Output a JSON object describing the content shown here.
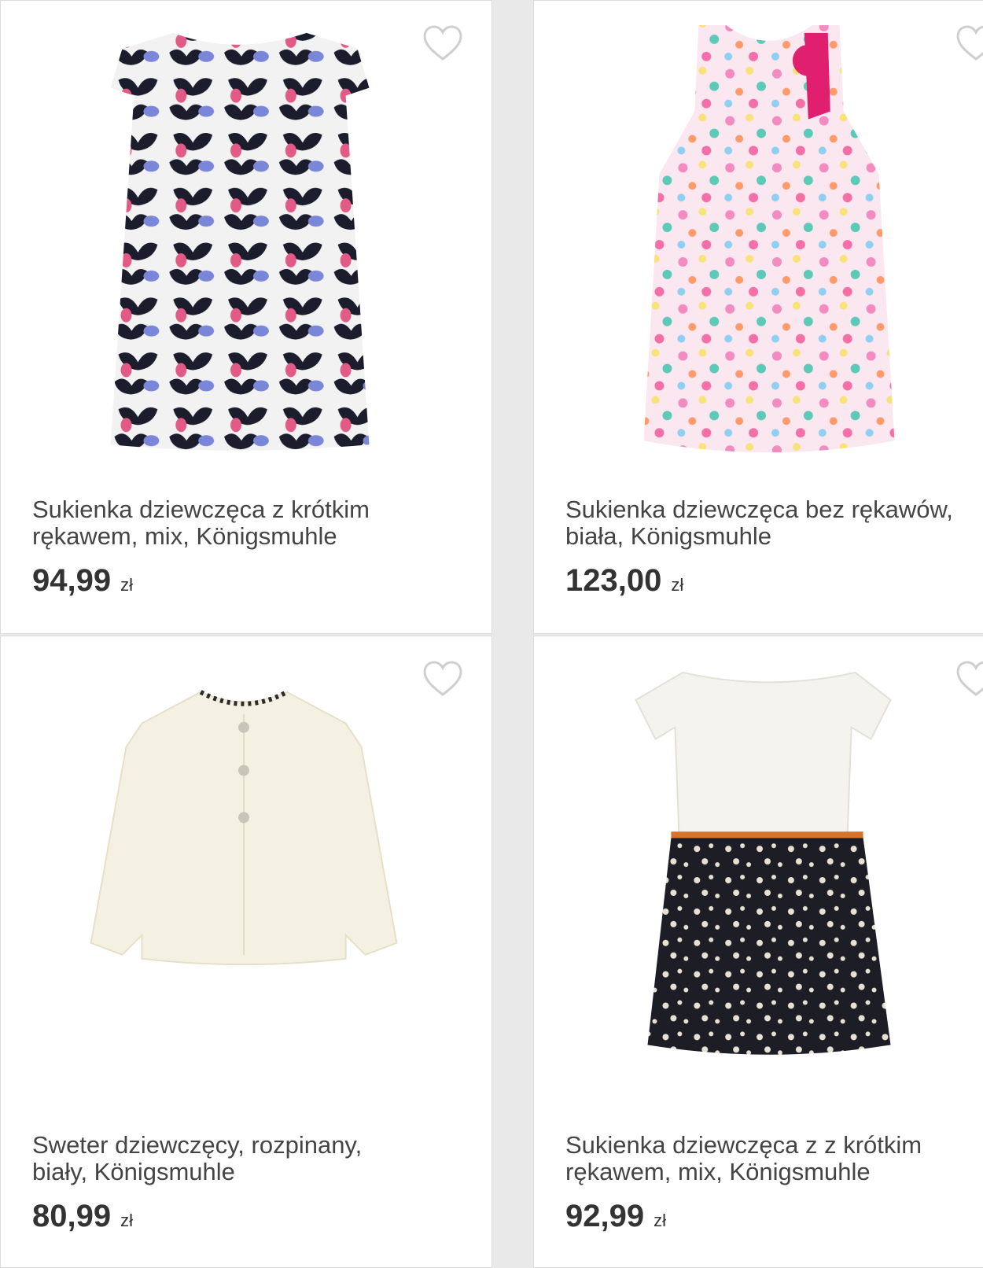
{
  "colors": {
    "background": "#e9e9e9",
    "card": "#ffffff",
    "text": "#444444",
    "heart": "#cfcfcf"
  },
  "products": [
    {
      "title_line1": "Sukienka dziewczęca z krótkim",
      "title_line2": "rękawem, mix, Königsmuhle",
      "price": "94,99",
      "currency": "zł",
      "icon": "heart-outline-icon"
    },
    {
      "title_line1": "Sukienka dziewczęca bez rękawów,",
      "title_line2": "biała, Königsmuhle",
      "price": "123,00",
      "currency": "zł",
      "icon": "heart-outline-icon"
    },
    {
      "title_line1": "Sweter dziewczęcy, rozpinany,",
      "title_line2": "biały, Königsmuhle",
      "price": "80,99",
      "currency": "zł",
      "icon": "heart-outline-icon"
    },
    {
      "title_line1": "Sukienka dziewczęca z z krótkim",
      "title_line2": "rękawem, mix, Königsmuhle",
      "price": "92,99",
      "currency": "zł",
      "icon": "heart-outline-icon"
    }
  ]
}
